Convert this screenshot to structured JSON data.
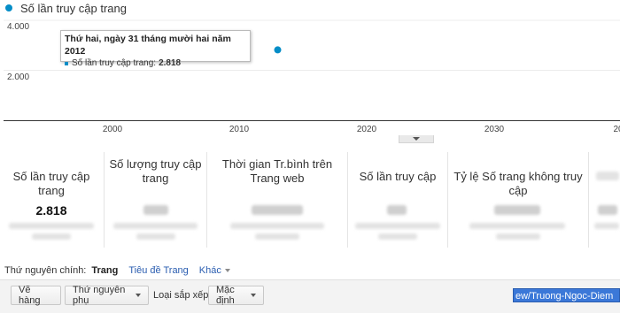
{
  "legend": {
    "label": "Số lần truy cập trang",
    "color": "#058dc7"
  },
  "chart_data": {
    "type": "scatter",
    "series": [
      {
        "name": "Số lần truy cập trang",
        "points": [
          {
            "x": 2012.9973,
            "y": 2818
          }
        ]
      }
    ],
    "x_ticks": [
      "2000",
      "2010",
      "2020",
      "2030",
      "20"
    ],
    "y_ticks": [
      "4.000",
      "2.000"
    ],
    "xlim": [
      1992,
      2039
    ],
    "ylim": [
      0,
      4500
    ],
    "grid": true
  },
  "tooltip": {
    "title": "Thứ hai, ngày 31 tháng mười hai năm 2012",
    "series_label": "Số lần truy cập trang:",
    "value": "2.818"
  },
  "metrics": [
    {
      "label": "Số lần truy cập trang",
      "value": "2.818"
    },
    {
      "label": "Số lượng truy cập trang",
      "value": ""
    },
    {
      "label": "Thời gian Tr.bình trên Trang web",
      "value": ""
    },
    {
      "label": "Số lần truy cập",
      "value": ""
    },
    {
      "label": "Tỷ lệ Số trang không truy cập",
      "value": ""
    }
  ],
  "dimension_row": {
    "label": "Thứ nguyên chính:",
    "selected": "Trang",
    "link1": "Tiêu đề Trang",
    "link2": "Khác"
  },
  "toolbar": {
    "plot_rows": "Vẽ hàng",
    "secondary_dimension": "Thứ nguyên phụ",
    "sort_label": "Loại sắp xếp:",
    "sort_value": "Mặc định",
    "search_value": "ew/Truong-Ngoc-Diem"
  }
}
